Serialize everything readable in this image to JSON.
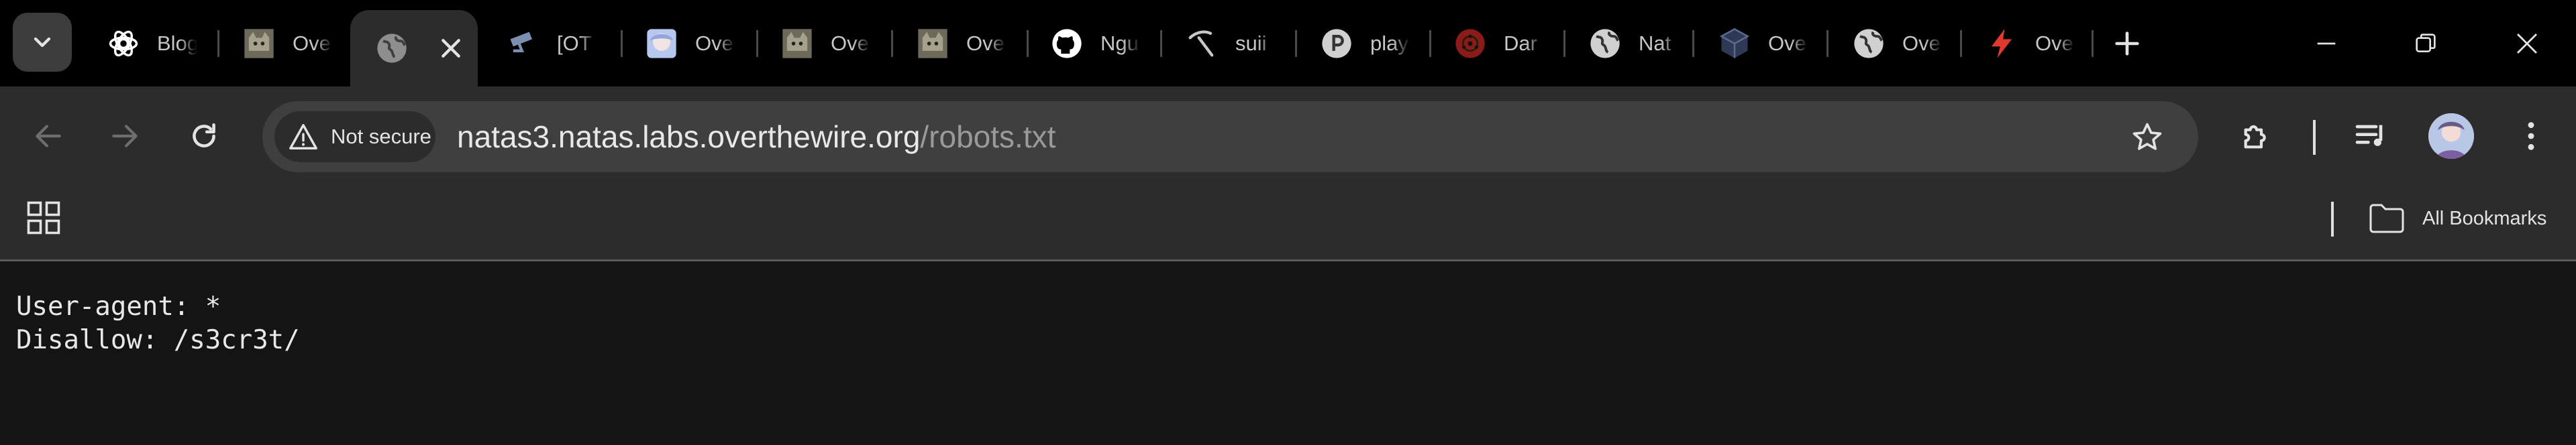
{
  "tabs": [
    {
      "title": "Blog",
      "favicon": "chatgpt-icon"
    },
    {
      "title": "Ove",
      "favicon": "cat-icon"
    },
    {
      "title": "",
      "favicon": "globe-icon",
      "active": true
    },
    {
      "title": "[OT",
      "favicon": "cctv-icon"
    },
    {
      "title": "Ove",
      "favicon": "anime-avatar-icon"
    },
    {
      "title": "Ove",
      "favicon": "cat-icon"
    },
    {
      "title": "Ove",
      "favicon": "cat-icon"
    },
    {
      "title": "Ngu",
      "favicon": "github-icon"
    },
    {
      "title": "suii",
      "favicon": "pickaxe-icon"
    },
    {
      "title": "play",
      "favicon": "p-circle-icon"
    },
    {
      "title": "Dar",
      "favicon": "sharingan-icon"
    },
    {
      "title": "Nat",
      "favicon": "globe-icon"
    },
    {
      "title": "Ove",
      "favicon": "cube-icon"
    },
    {
      "title": "Ove",
      "favicon": "globe-icon"
    },
    {
      "title": "Ove",
      "favicon": "bolt-icon"
    }
  ],
  "toolbar": {
    "security_chip": "Not secure",
    "url_host": "natas3.natas.labs.overthewire.org",
    "url_path": "/robots.txt"
  },
  "bookmarks": {
    "all_bookmarks_label": "All Bookmarks"
  },
  "page": {
    "line1": "User-agent: *",
    "line2": "Disallow: /s3cr3t/"
  },
  "colors": {
    "tabstrip": "#000000",
    "toolbar": "#2c2c2c",
    "omnibox": "#3f3f3f",
    "page_bg": "#141414"
  }
}
